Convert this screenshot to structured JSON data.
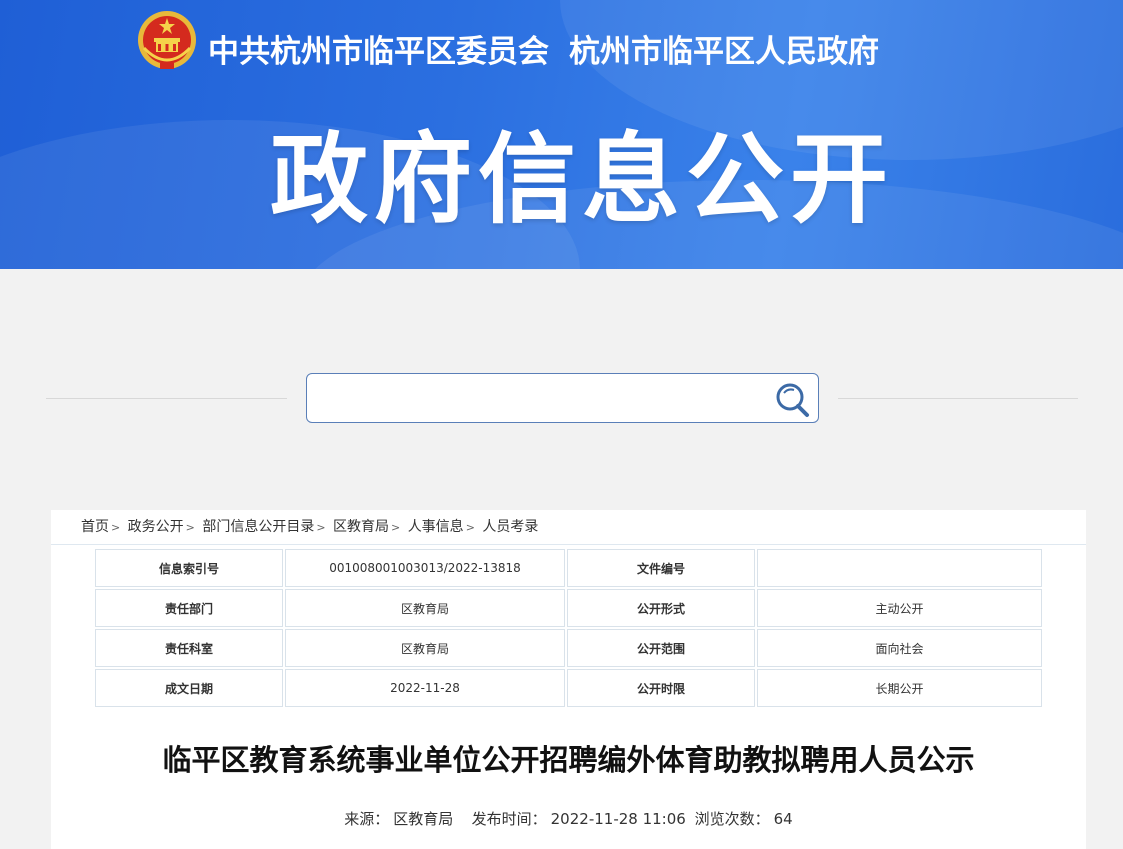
{
  "header": {
    "org_party": "中共杭州市临平区委员会",
    "org_gov": "杭州市临平区人民政府",
    "big_title": "政府信息公开",
    "brand_color": "#2b6fe0"
  },
  "search": {
    "placeholder": "",
    "icon": "search-icon"
  },
  "breadcrumb": [
    "首页",
    "政务公开",
    "部门信息公开目录",
    "区教育局",
    "人事信息",
    "人员考录"
  ],
  "meta_table": [
    {
      "k1": "信息索引号",
      "v1": "001008001003013/2022-13818",
      "k2": "文件编号",
      "v2": ""
    },
    {
      "k1": "责任部门",
      "v1": "区教育局",
      "k2": "公开形式",
      "v2": "主动公开"
    },
    {
      "k1": "责任科室",
      "v1": "区教育局",
      "k2": "公开范围",
      "v2": "面向社会"
    },
    {
      "k1": "成文日期",
      "v1": "2022-11-28",
      "k2": "公开时限",
      "v2": "长期公开"
    }
  ],
  "article": {
    "title": "临平区教育系统事业单位公开招聘编外体育助教拟聘用人员公示",
    "source_label": "来源：",
    "source": "区教育局",
    "time_label": "发布时间：",
    "time": "2022-11-28 11:06",
    "views_label": "浏览次数：",
    "views": "64"
  }
}
